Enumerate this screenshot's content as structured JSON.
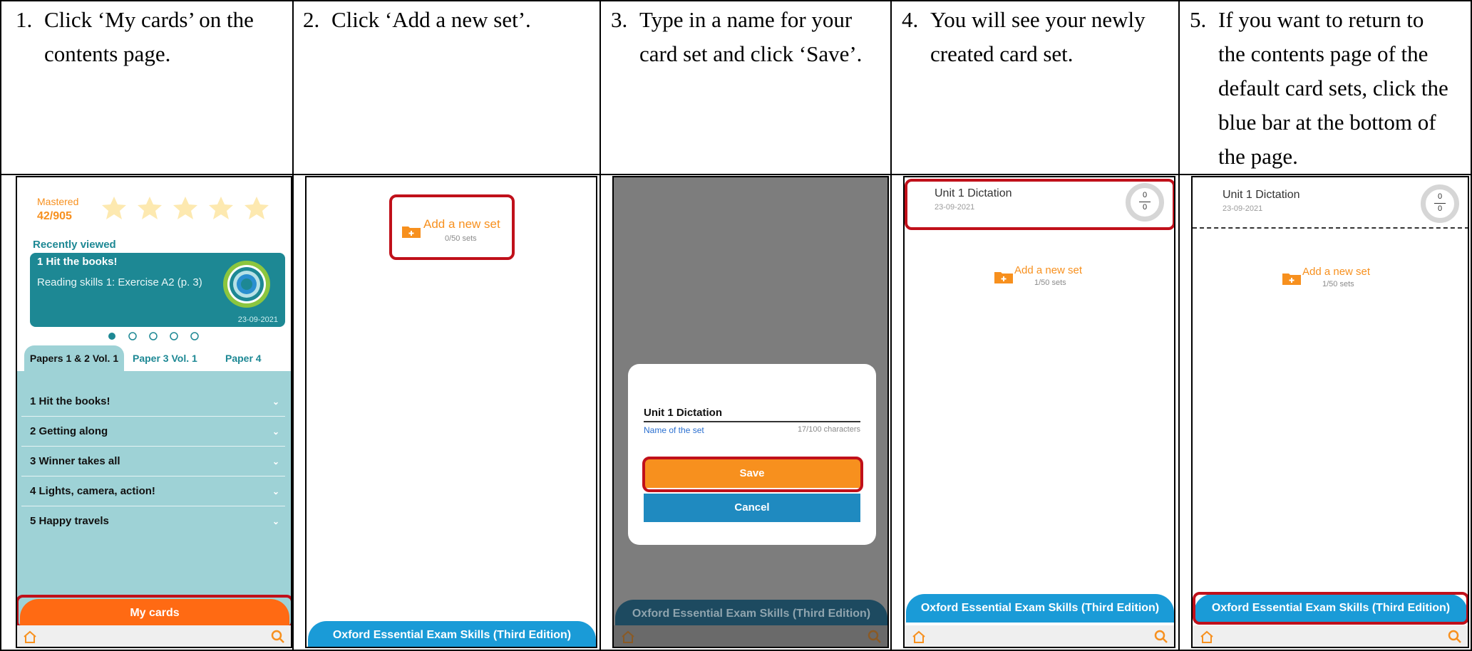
{
  "instructions": [
    {
      "num": "1.",
      "lines": [
        "Click ‘My cards’ on the",
        "contents page."
      ]
    },
    {
      "num": "2.",
      "lines": [
        "Click ‘Add a new set’."
      ]
    },
    {
      "num": "3.",
      "lines": [
        "Type in a name for your",
        "card set and click ‘Save’."
      ]
    },
    {
      "num": "4.",
      "lines": [
        "You will see your newly",
        "created card set."
      ]
    },
    {
      "num": "5.",
      "lines": [
        "If you want to return to",
        "the contents page of the",
        "default card sets, click the",
        "blue bar at the bottom of",
        "the page."
      ]
    }
  ],
  "screen1": {
    "mastered_label": "Mastered",
    "mastered_count": "42/905",
    "recently_viewed": "Recently viewed",
    "card_title": "1 Hit the books!",
    "card_body": "Reading skills 1: Exercise A2 (p. 3)",
    "card_date": "23-09-2021",
    "tabs": [
      "Papers 1 & 2 Vol. 1",
      "Paper 3 Vol. 1",
      "Paper 4"
    ],
    "units": [
      "1 Hit the books!",
      "2 Getting along",
      "3 Winner takes all",
      "4 Lights, camera, action!",
      "5 Happy travels"
    ],
    "my_cards": "My cards",
    "chevron": "⌄"
  },
  "screen2": {
    "add_set": "Add a new set",
    "sets_count": "0/50 sets",
    "footer": "Oxford Essential Exam Skills (Third Edition)"
  },
  "screen3": {
    "input_value": "Unit 1 Dictation",
    "input_label": "Name of the set",
    "char_count": "17/100 characters",
    "save": "Save",
    "cancel": "Cancel",
    "footer": "Oxford Essential Exam Skills (Third Edition)"
  },
  "screen4": {
    "set_title": "Unit 1 Dictation",
    "set_date": "23-09-2021",
    "ring_top": "0",
    "ring_bot": "0",
    "add_set": "Add a new set",
    "sets_count": "1/50 sets",
    "footer": "Oxford Essential Exam Skills (Third Edition)"
  },
  "screen5": {
    "set_title": "Unit 1 Dictation",
    "set_date": "23-09-2021",
    "ring_top": "0",
    "ring_bot": "0",
    "add_set": "Add a new set",
    "sets_count": "1/50 sets",
    "footer": "Oxford Essential Exam Skills (Third Edition)"
  },
  "colors": {
    "orange": "#f7901e",
    "teal": "#1d8894",
    "light_teal": "#9ed2d6",
    "blue_bar": "#1a9bd7",
    "red_highlight": "#c0101a",
    "my_cards_orange": "#ff6a13"
  },
  "icons": [
    "home-icon",
    "search-icon",
    "folder-add-icon",
    "star-icon",
    "chevron-down-icon"
  ]
}
